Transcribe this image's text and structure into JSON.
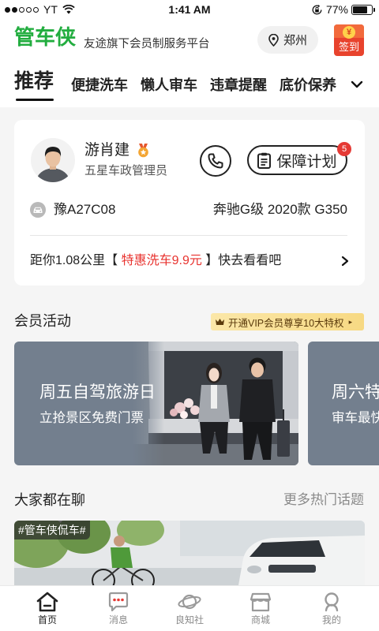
{
  "status_bar": {
    "carrier": "YT",
    "signal_bars_filled": 2,
    "signal_bars_total": 5,
    "time": "1:41 AM",
    "battery": "77%",
    "icons": [
      "signal-dots-icon",
      "wifi-icon",
      "rotation-lock-icon",
      "battery-icon"
    ]
  },
  "header": {
    "logo": "管车侠",
    "slogan": "友途旗下会员制服务平台",
    "city": "郑州",
    "sign_in_coin": "¥",
    "sign_in_label": "签到",
    "icons": [
      "location-pin-icon",
      "sign-in-icon"
    ]
  },
  "tabs": {
    "items": [
      "推荐",
      "便捷洗车",
      "懒人审车",
      "违章提醒",
      "底价保养"
    ],
    "active_index": 0,
    "more_icon": "chevron-down-icon"
  },
  "manager_card": {
    "name": "游肖建",
    "role": "五星车政管理员",
    "plan_label": "保障计划",
    "plan_badge": "5",
    "car_plate": "豫A27C08",
    "car_model": "奔驰G级 2020款 G350",
    "promo": {
      "prefix": "距你1.08公里【 ",
      "highlight": "特惠洗车9.9元",
      "suffix": " 】快去看看吧"
    },
    "icons": [
      "avatar",
      "medal-icon",
      "phone-icon",
      "clipboard-icon",
      "car-icon",
      "chevron-right-icon"
    ]
  },
  "member_activities": {
    "title": "会员活动",
    "vip_label": "开通VIP会员尊享10大特权",
    "vip_arrow": "▸",
    "banners": [
      {
        "title": "周五自驾旅游日",
        "subtitle": "立抢景区免费门票"
      },
      {
        "title": "周六特",
        "subtitle": "审车最快"
      }
    ]
  },
  "discussion": {
    "title": "大家都在聊",
    "more_label": "更多热门话题",
    "topic_tag": "#管车侠侃车#"
  },
  "bottom_nav": {
    "items": [
      {
        "label": "首页",
        "icon": "home-icon"
      },
      {
        "label": "消息",
        "icon": "message-icon"
      },
      {
        "label": "良知社",
        "icon": "planet-icon"
      },
      {
        "label": "商城",
        "icon": "store-icon"
      },
      {
        "label": "我的",
        "icon": "person-icon"
      }
    ],
    "active_index": 0
  },
  "colors": {
    "brand_green": "#22ad3f",
    "highlight_red": "#e8332f",
    "badge_red": "#e53a35",
    "vip_gold": "#f7d983",
    "banner_slate": "#737f8e",
    "active_text": "#222222",
    "inactive_text": "#8a8a8a"
  }
}
